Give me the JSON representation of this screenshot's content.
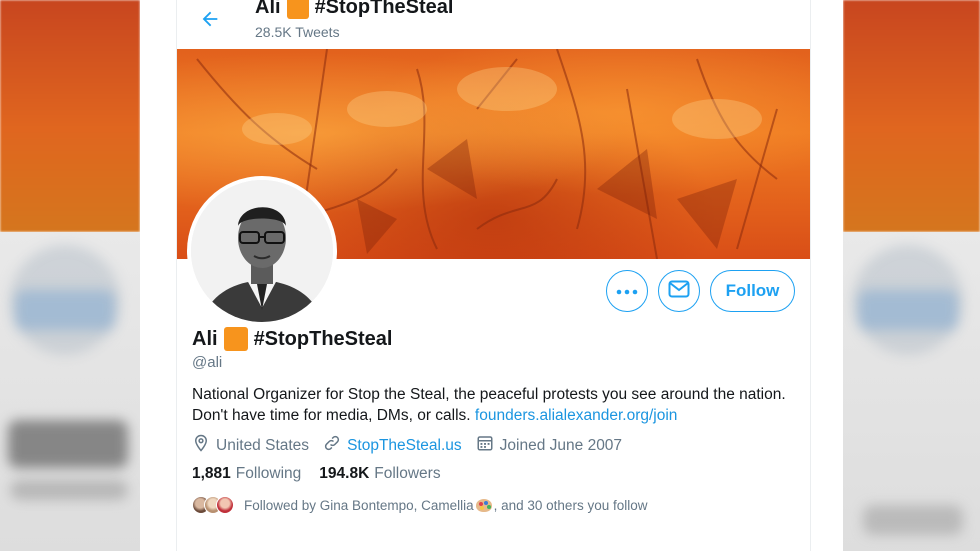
{
  "header": {
    "name_prefix": "Ali",
    "name_suffix": "#StopTheSteal",
    "tweet_count": "28.5K Tweets"
  },
  "profile": {
    "name_prefix": "Ali",
    "name_suffix": "#StopTheSteal",
    "handle": "@ali",
    "bio_text": "National Organizer for Stop the Steal, the peaceful protests you see around the nation. Don't have time for media, DMs, or calls.",
    "bio_link": "founders.alialexander.org/join",
    "location": "United States",
    "website": "StopTheSteal.us",
    "joined": "Joined June 2007",
    "following_count": "1,881",
    "following_label": "Following",
    "followers_count": "194.8K",
    "followers_label": "Followers"
  },
  "actions": {
    "follow_label": "Follow"
  },
  "followed_by": {
    "text_before": "Followed by Gina Bontempo, Camellia",
    "text_after": ", and 30 others you follow"
  },
  "icons": {
    "back": "arrow-left-icon",
    "more": "more-dots-icon",
    "message": "envelope-icon",
    "location": "location-pin-icon",
    "website": "link-icon",
    "joined": "calendar-icon",
    "name_emoji": "orange-square-emoji",
    "follower_emoji": "artist-palette-emoji"
  },
  "colors": {
    "accent": "#1da1f2",
    "link": "#1b95e0",
    "text_primary": "#14171a",
    "text_secondary": "#657786",
    "orange_square": "#f7941d"
  }
}
